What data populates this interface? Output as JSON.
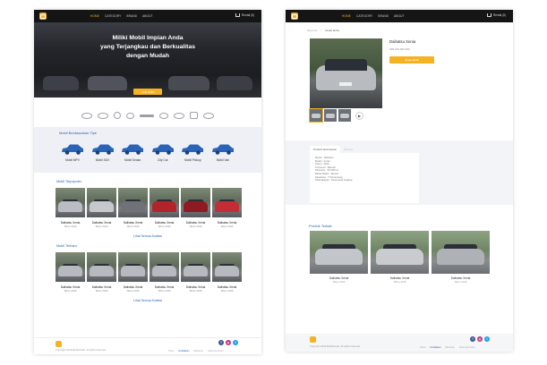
{
  "nav": {
    "items": [
      "HOME",
      "CATEGORY",
      "BRAND",
      "ABOUT"
    ],
    "cart_label": "Rental (0)"
  },
  "hero": {
    "line1": "Miliki Mobil Impian Anda",
    "line2": "yang Terjangkau dan Berkualitas",
    "line3": "dengan Mudah",
    "button": "Lihat Mobil"
  },
  "types": {
    "title": "Mobil Berdasarkan Tipe",
    "items": [
      "Mobil MPV",
      "Mobil SUV",
      "Mobil Sedan",
      "City Car",
      "Mobil Pickup",
      "Mobil Van"
    ]
  },
  "popular": {
    "title": "Mobil Terpopuler",
    "cars": [
      {
        "name": "Daihatsu Xenia",
        "year": "Tahun 2016",
        "color": "#b9bcc2"
      },
      {
        "name": "Daihatsu Xenia",
        "year": "Tahun 2016",
        "color": "#c6c9cc"
      },
      {
        "name": "Daihatsu Xenia",
        "year": "Tahun 2016",
        "color": "#6f7276"
      },
      {
        "name": "Daihatsu Xenia",
        "year": "Tahun 2016",
        "color": "#b3232a"
      },
      {
        "name": "Daihatsu Xenia",
        "year": "Tahun 2016",
        "color": "#8f1b22"
      },
      {
        "name": "Daihatsu Xenia",
        "year": "Tahun 2016",
        "color": "#c32d35"
      }
    ],
    "link": "Lihat Semua Koleksi"
  },
  "newest": {
    "title": "Mobil Terbaru",
    "cars": [
      {
        "name": "Daihatsu Xenia",
        "year": "Tahun 2016",
        "color": "#b6babf"
      },
      {
        "name": "Daihatsu Xenia",
        "year": "Tahun 2016",
        "color": "#b6babf"
      },
      {
        "name": "Daihatsu Xenia",
        "year": "Tahun 2016",
        "color": "#b6babf"
      },
      {
        "name": "Daihatsu Xenia",
        "year": "Tahun 2016",
        "color": "#b6babf"
      },
      {
        "name": "Daihatsu Xenia",
        "year": "Tahun 2016",
        "color": "#b6babf"
      },
      {
        "name": "Daihatsu Xenia",
        "year": "Tahun 2016",
        "color": "#b6babf"
      }
    ],
    "link": "Lihat Semua Koleksi"
  },
  "footer": {
    "copyright": "Copyright 2019 Mobilmurah. All rights reserved",
    "links": [
      "Kami",
      "Kebijakan",
      "Bantuan",
      "Hubungi Kami"
    ],
    "socials": [
      {
        "icon": "facebook-icon",
        "glyph": "f",
        "color": "#3b5998"
      },
      {
        "icon": "instagram-icon",
        "glyph": "◎",
        "color": "#c13584"
      },
      {
        "icon": "twitter-icon",
        "glyph": "t",
        "color": "#1da1f2"
      }
    ]
  },
  "detail": {
    "breadcrumb": [
      "Beranda",
      "/",
      "Detail Mobil"
    ],
    "name": "Daihatsu Xenia",
    "price": "IDR 100.000.000",
    "order_button": "Sewa Mobil",
    "tabs": [
      "Product Description",
      "Review"
    ],
    "description": [
      "Merek : Daihatsu",
      "Model : Xenia",
      "Tahun : 2016",
      "Transmisi : Manual",
      "Kilometer : 50.000 km",
      "Bahan Bakar : Bensin",
      "Kapasitas : 7 Penumpang",
      "Kelengkapan : Surat-surat lengkap"
    ],
    "related_title": "Produk Terkait",
    "related": [
      {
        "name": "Daihatsu Xenia",
        "year": "Tahun 2016",
        "color": "#c2c5c9"
      },
      {
        "name": "Daihatsu Xenia",
        "year": "Tahun 2016",
        "color": "#c9cbce"
      },
      {
        "name": "Daihatsu Xenia",
        "year": "Tahun 2016",
        "color": "#aeb1b6"
      }
    ]
  }
}
